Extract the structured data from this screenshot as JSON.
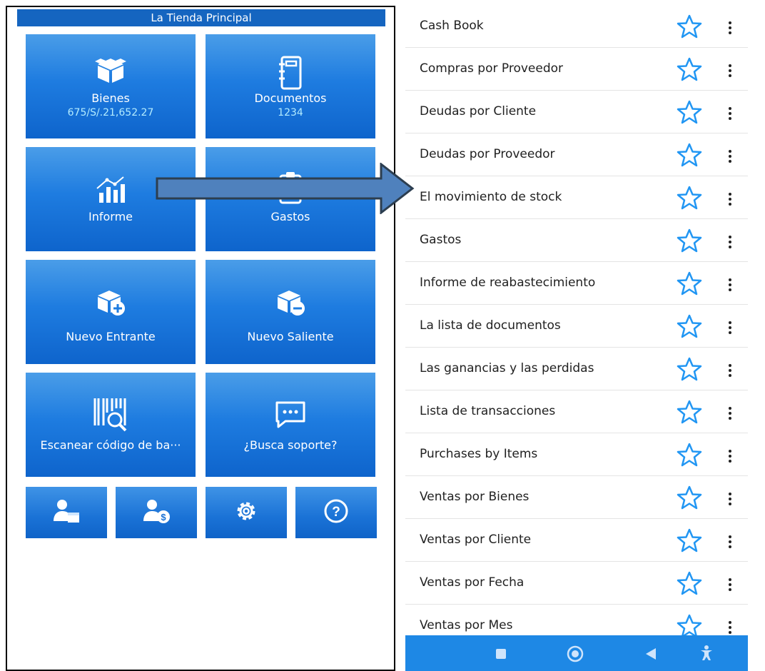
{
  "left": {
    "store_name": "La Tienda Principal",
    "tiles": [
      {
        "title": "Bienes",
        "subtitle": "675/S/.21,652.27",
        "icon": "box-icon"
      },
      {
        "title": "Documentos",
        "subtitle": "1234",
        "icon": "notebook-icon"
      },
      {
        "title": "Informe",
        "subtitle": "",
        "icon": "chart-icon"
      },
      {
        "title": "Gastos",
        "subtitle": "",
        "icon": "clipboard-icon"
      },
      {
        "title": "Nuevo Entrante",
        "subtitle": "",
        "icon": "box-add-icon"
      },
      {
        "title": "Nuevo Saliente",
        "subtitle": "",
        "icon": "box-remove-icon"
      },
      {
        "title": "Escanear código de ba···",
        "subtitle": "",
        "icon": "barcode-scan-icon"
      },
      {
        "title": "¿Busca soporte?",
        "subtitle": "",
        "icon": "chat-icon"
      }
    ],
    "small_buttons": [
      "supplier-icon",
      "customer-money-icon",
      "gear-icon",
      "help-icon"
    ]
  },
  "right": {
    "reports": [
      "Cash Book",
      "Compras por Proveedor",
      "Deudas por Cliente",
      "Deudas por Proveedor",
      "El movimiento de stock",
      "Gastos",
      "Informe de reabastecimiento",
      "La lista de documentos",
      "Las ganancias y las perdidas",
      "Lista de transacciones",
      "Purchases by Items",
      "Ventas por Bienes",
      "Ventas por Cliente",
      "Ventas por Fecha",
      "Ventas por Mes"
    ],
    "navbar": [
      "square-icon",
      "home-circle-icon",
      "back-triangle-icon",
      "accessibility-icon"
    ]
  },
  "colors": {
    "tile_blue": "#1e7ce0",
    "bar_blue": "#1565c0",
    "navbar_blue": "#1e88e5",
    "star_blue": "#2196f3",
    "arrow_fill": "#4f81bd"
  }
}
